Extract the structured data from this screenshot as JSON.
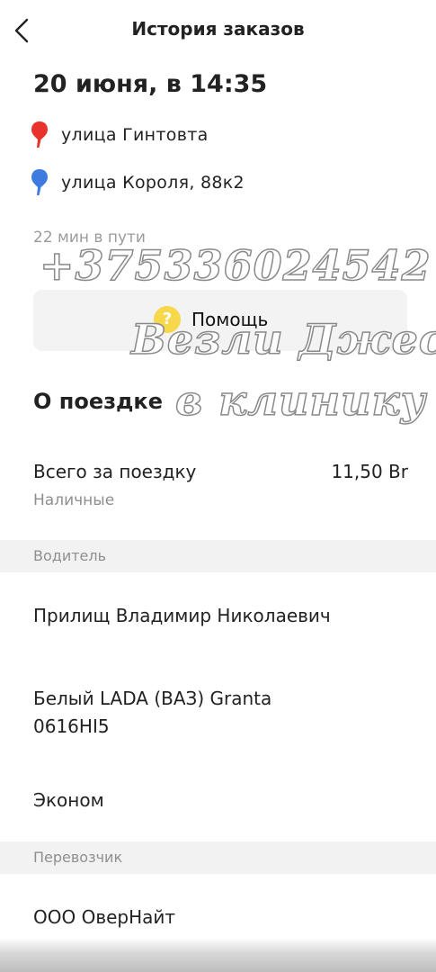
{
  "header": {
    "title": "История заказов"
  },
  "order": {
    "date": "20 июня, в 14:35",
    "from": "улица Гинтовта",
    "to": "улица Короля, 88к2",
    "duration": "22 мин в пути",
    "help_label": "Помощь"
  },
  "trip": {
    "section_title": "О поездке",
    "total_label": "Всего за поездку",
    "total_value": "11,50 Br",
    "payment": "Наличные"
  },
  "driver": {
    "section_label": "Водитель",
    "name": "Прилищ Владимир Николаевич",
    "car": "Белый LADA (ВАЗ) Granta",
    "plate": "0616HI5",
    "tariff": "Эконом"
  },
  "carrier": {
    "section_label": "Перевозчик",
    "name": "ООО ОверНайт"
  },
  "watermark": {
    "phone": "+375336024542",
    "line2": "Везли Джес",
    "line3": "в клинику"
  },
  "icons": {
    "back": "back-arrow-icon",
    "from_pin": "red-pin-icon",
    "to_pin": "blue-pin-icon",
    "help": "question-icon"
  },
  "colors": {
    "from_pin": "#e8322b",
    "to_pin": "#3d7be0",
    "help_icon": "#f7d84b",
    "muted_text": "#9b9b9b",
    "section_bg": "#f2f2f2"
  }
}
